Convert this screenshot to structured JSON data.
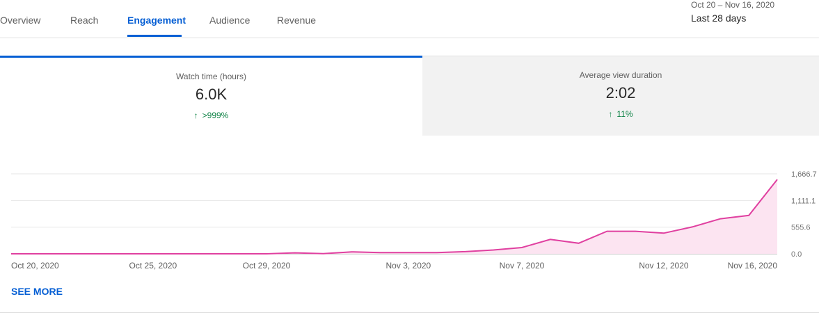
{
  "tabs": [
    {
      "label": "Overview"
    },
    {
      "label": "Reach"
    },
    {
      "label": "Engagement",
      "active": true
    },
    {
      "label": "Audience"
    },
    {
      "label": "Revenue"
    }
  ],
  "date_range": {
    "range": "Oct 20 – Nov 16, 2020",
    "preset": "Last 28 days"
  },
  "metrics": [
    {
      "label": "Watch time (hours)",
      "value": "6.0K",
      "delta": ">999%"
    },
    {
      "label": "Average view duration",
      "value": "2:02",
      "delta": "11%"
    }
  ],
  "see_more": "SEE MORE",
  "colors": {
    "accent": "#065fd4",
    "line": "#e040a0",
    "fill": "#fce4f1",
    "positive": "#0b8043"
  },
  "chart_data": {
    "type": "area",
    "x": [
      "Oct 20",
      "Oct 21",
      "Oct 22",
      "Oct 23",
      "Oct 24",
      "Oct 25",
      "Oct 26",
      "Oct 27",
      "Oct 28",
      "Oct 29",
      "Oct 30",
      "Oct 31",
      "Nov 1",
      "Nov 2",
      "Nov 3",
      "Nov 4",
      "Nov 5",
      "Nov 6",
      "Nov 7",
      "Nov 8",
      "Nov 9",
      "Nov 10",
      "Nov 11",
      "Nov 12",
      "Nov 13",
      "Nov 14",
      "Nov 15",
      "Nov 16"
    ],
    "series": [
      {
        "values": [
          0,
          0,
          0,
          0,
          0,
          0,
          0,
          0,
          0,
          0,
          20,
          5,
          40,
          25,
          25,
          25,
          45,
          80,
          130,
          300,
          220,
          470,
          470,
          430,
          560,
          730,
          800,
          1550
        ]
      }
    ],
    "y_ticks": [
      "1,666.7",
      "1,111.1",
      "555.6",
      "0.0"
    ],
    "x_tick_labels": [
      {
        "index": 0,
        "label": "Oct 20, 2020"
      },
      {
        "index": 5,
        "label": "Oct 25, 2020"
      },
      {
        "index": 9,
        "label": "Oct 29, 2020"
      },
      {
        "index": 14,
        "label": "Nov 3, 2020"
      },
      {
        "index": 18,
        "label": "Nov 7, 2020"
      },
      {
        "index": 23,
        "label": "Nov 12, 2020"
      },
      {
        "index": 27,
        "label": "Nov 16, 2020"
      }
    ],
    "ylim": [
      0,
      1666.7
    ],
    "grid": true
  }
}
